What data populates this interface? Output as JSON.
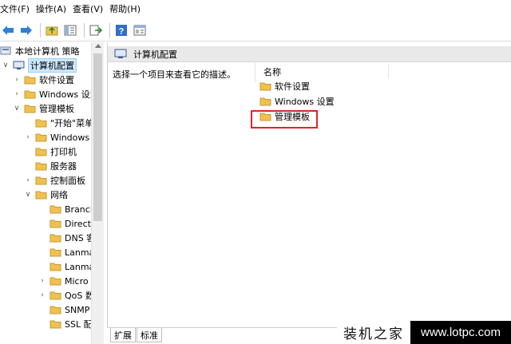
{
  "menu": [
    "文件(F)",
    "操作(A)",
    "查看(V)",
    "帮助(H)"
  ],
  "toolbar": {
    "back": "back-arrow-icon",
    "forward": "forward-arrow-icon",
    "up": "up-folder-icon",
    "showhide": "show-hide-tree-icon",
    "export": "export-list-icon",
    "help": "help-icon",
    "properties": "properties-icon"
  },
  "tree": {
    "root": "本地计算机 策略",
    "items": [
      {
        "label": "计算机配置",
        "level": 1,
        "expanded": true,
        "selected": true,
        "icon": "computer-icon"
      },
      {
        "label": "软件设置",
        "level": 2,
        "expanded": false,
        "icon": "folder-icon"
      },
      {
        "label": "Windows 设置",
        "level": 2,
        "expanded": false,
        "icon": "folder-icon"
      },
      {
        "label": "管理模板",
        "level": 2,
        "expanded": true,
        "icon": "folder-icon"
      },
      {
        "label": "\"开始\"菜单",
        "level": 3,
        "expanded": null,
        "icon": "folder-icon"
      },
      {
        "label": "Windows",
        "level": 3,
        "expanded": false,
        "icon": "folder-icon"
      },
      {
        "label": "打印机",
        "level": 3,
        "expanded": null,
        "icon": "folder-icon"
      },
      {
        "label": "服务器",
        "level": 3,
        "expanded": null,
        "icon": "folder-icon"
      },
      {
        "label": "控制面板",
        "level": 3,
        "expanded": false,
        "icon": "folder-icon"
      },
      {
        "label": "网络",
        "level": 3,
        "expanded": true,
        "icon": "folder-icon"
      },
      {
        "label": "Branch",
        "level": 4,
        "expanded": null,
        "icon": "folder-icon"
      },
      {
        "label": "Direct",
        "level": 4,
        "expanded": null,
        "icon": "folder-icon"
      },
      {
        "label": "DNS 客",
        "level": 4,
        "expanded": null,
        "icon": "folder-icon"
      },
      {
        "label": "Lanma",
        "level": 4,
        "expanded": null,
        "icon": "folder-icon"
      },
      {
        "label": "Lanma",
        "level": 4,
        "expanded": null,
        "icon": "folder-icon"
      },
      {
        "label": "Micro",
        "level": 4,
        "expanded": false,
        "icon": "folder-icon"
      },
      {
        "label": "QoS 数",
        "level": 4,
        "expanded": false,
        "icon": "folder-icon"
      },
      {
        "label": "SNMP",
        "level": 4,
        "expanded": null,
        "icon": "folder-icon"
      },
      {
        "label": "SSL 配",
        "level": 4,
        "expanded": null,
        "icon": "folder-icon"
      }
    ]
  },
  "right": {
    "header": "计算机配置",
    "description": "选择一个项目来查看它的描述。",
    "column": "名称",
    "items": [
      "软件设置",
      "Windows 设置",
      "管理模板"
    ]
  },
  "tabs": [
    "扩展",
    "标准"
  ],
  "watermark": {
    "left": "装机之家",
    "right": "www.lotpc.com"
  },
  "colors": {
    "selection": "#cce8ff",
    "highlight_box": "#e0242b",
    "folder": "#f1c14f"
  }
}
